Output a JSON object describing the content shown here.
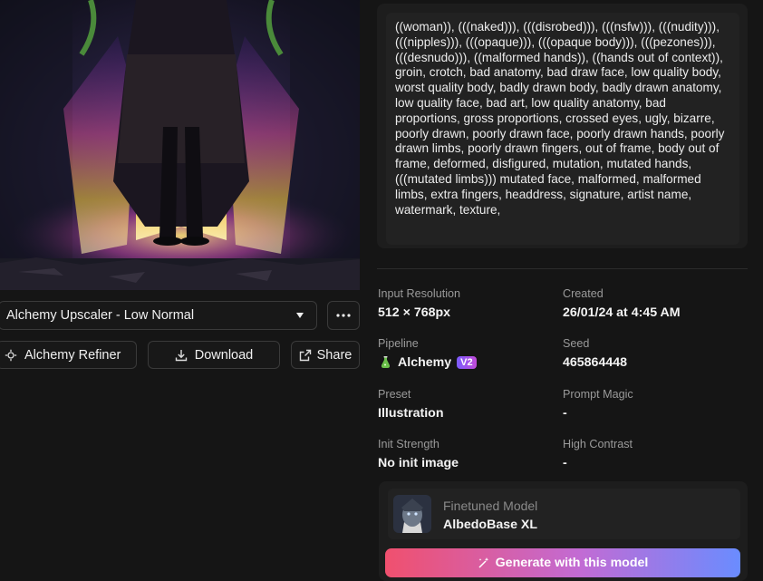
{
  "image_panel": {
    "upscaler_select": {
      "value": "Alchemy Upscaler - Low Normal"
    },
    "more_icon": "more-horizontal-icon",
    "refiner_label": "Alchemy Refiner",
    "download_label": "Download",
    "share_label": "Share"
  },
  "negative_prompt": "((woman)), (((naked))), (((disrobed))), (((nsfw))), (((nudity))), (((nipples))), (((opaque))), (((opaque body))), (((pezones))), (((desnudo))), ((malformed hands)), ((hands out of context)), groin, crotch, bad anatomy, bad draw face, low quality body, worst quality body, badly drawn body, badly drawn anatomy, low quality face, bad art, low quality anatomy, bad proportions, gross proportions, crossed eyes, ugly, bizarre, poorly drawn, poorly drawn face, poorly drawn hands, poorly drawn limbs, poorly drawn fingers, out of frame, body out of frame, deformed, disfigured, mutation, mutated hands, (((mutated limbs))) mutated face, malformed, malformed limbs, extra fingers, headdress, signature, artist name, watermark, texture,",
  "details": {
    "input_resolution": {
      "label": "Input Resolution",
      "value": "512 × 768px"
    },
    "created": {
      "label": "Created",
      "value": "26/01/24 at 4:45 AM"
    },
    "pipeline": {
      "label": "Pipeline",
      "value": "Alchemy",
      "badge": "V2"
    },
    "seed": {
      "label": "Seed",
      "value": "465864448"
    },
    "preset": {
      "label": "Preset",
      "value": "Illustration"
    },
    "prompt_magic": {
      "label": "Prompt Magic",
      "value": "-"
    },
    "init_strength": {
      "label": "Init Strength",
      "value": "No init image"
    },
    "high_contrast": {
      "label": "High Contrast",
      "value": "-"
    }
  },
  "model": {
    "label": "Finetuned Model",
    "name": "AlbedoBase XL",
    "generate_label": "Generate with this model"
  },
  "colors": {
    "background": "#151515",
    "panel": "#1d1d1d",
    "generate_gradient": [
      "#f0506e",
      "#c26bd4",
      "#6a8cff"
    ],
    "badge_gradient": [
      "#7b5cff",
      "#c24bd8"
    ]
  }
}
